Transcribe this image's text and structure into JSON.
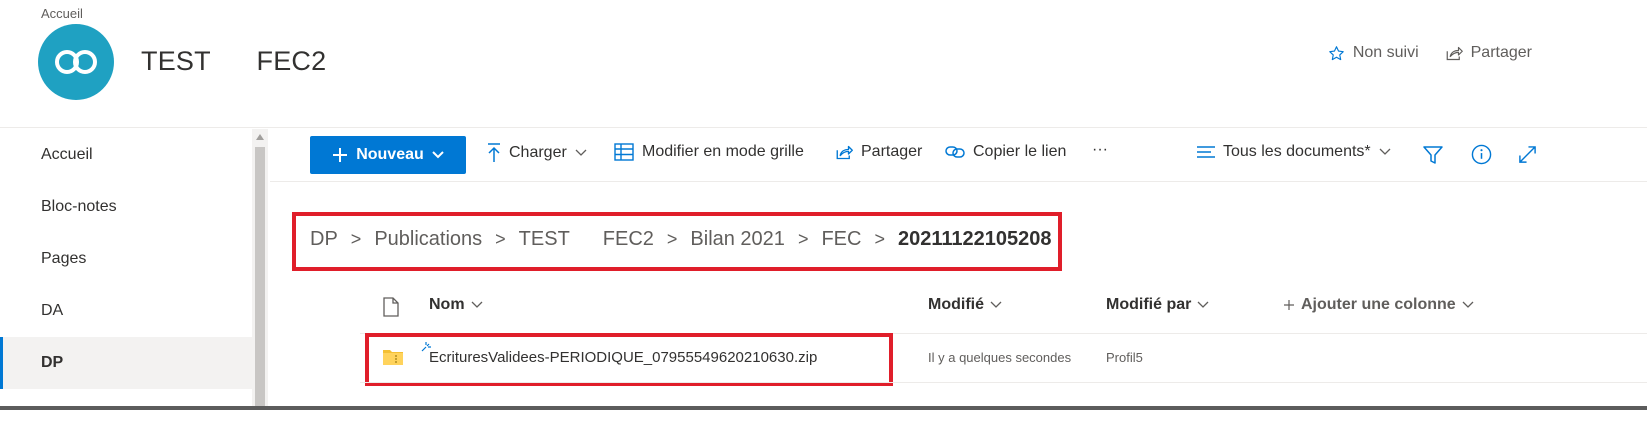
{
  "header": {
    "breadcrumb_top": "Accueil",
    "site_title": "TEST      FEC2",
    "follow_label": "Non suivi",
    "share_label": "Partager"
  },
  "leftnav": {
    "items": [
      {
        "label": "Accueil"
      },
      {
        "label": "Bloc-notes"
      },
      {
        "label": "Pages"
      },
      {
        "label": "DA"
      },
      {
        "label": "DP"
      }
    ],
    "active": "DP"
  },
  "commandbar": {
    "new_label": "Nouveau",
    "upload_label": "Charger",
    "grid_label": "Modifier en mode grille",
    "share_label": "Partager",
    "copy_link_label": "Copier le lien",
    "more_label": "···",
    "view_label": "Tous les documents*"
  },
  "breadcrumb": {
    "items": [
      "DP",
      "Publications",
      "TEST      FEC2",
      "Bilan 2021",
      "FEC"
    ],
    "current": "20211122105208"
  },
  "list": {
    "columns": {
      "name": "Nom",
      "modified": "Modifié",
      "modified_by": "Modifié par",
      "add_column": "Ajouter une colonne"
    },
    "rows": [
      {
        "name": "EcrituresValidees-PERIODIQUE_07955549620210630.zip",
        "modified": "Il y a quelques secondes",
        "modified_by": "Profil5"
      }
    ]
  },
  "colors": {
    "accent": "#0078d4",
    "logo": "#1fa1c2",
    "highlight": "#e01e2a",
    "folder": "#f4c034"
  }
}
